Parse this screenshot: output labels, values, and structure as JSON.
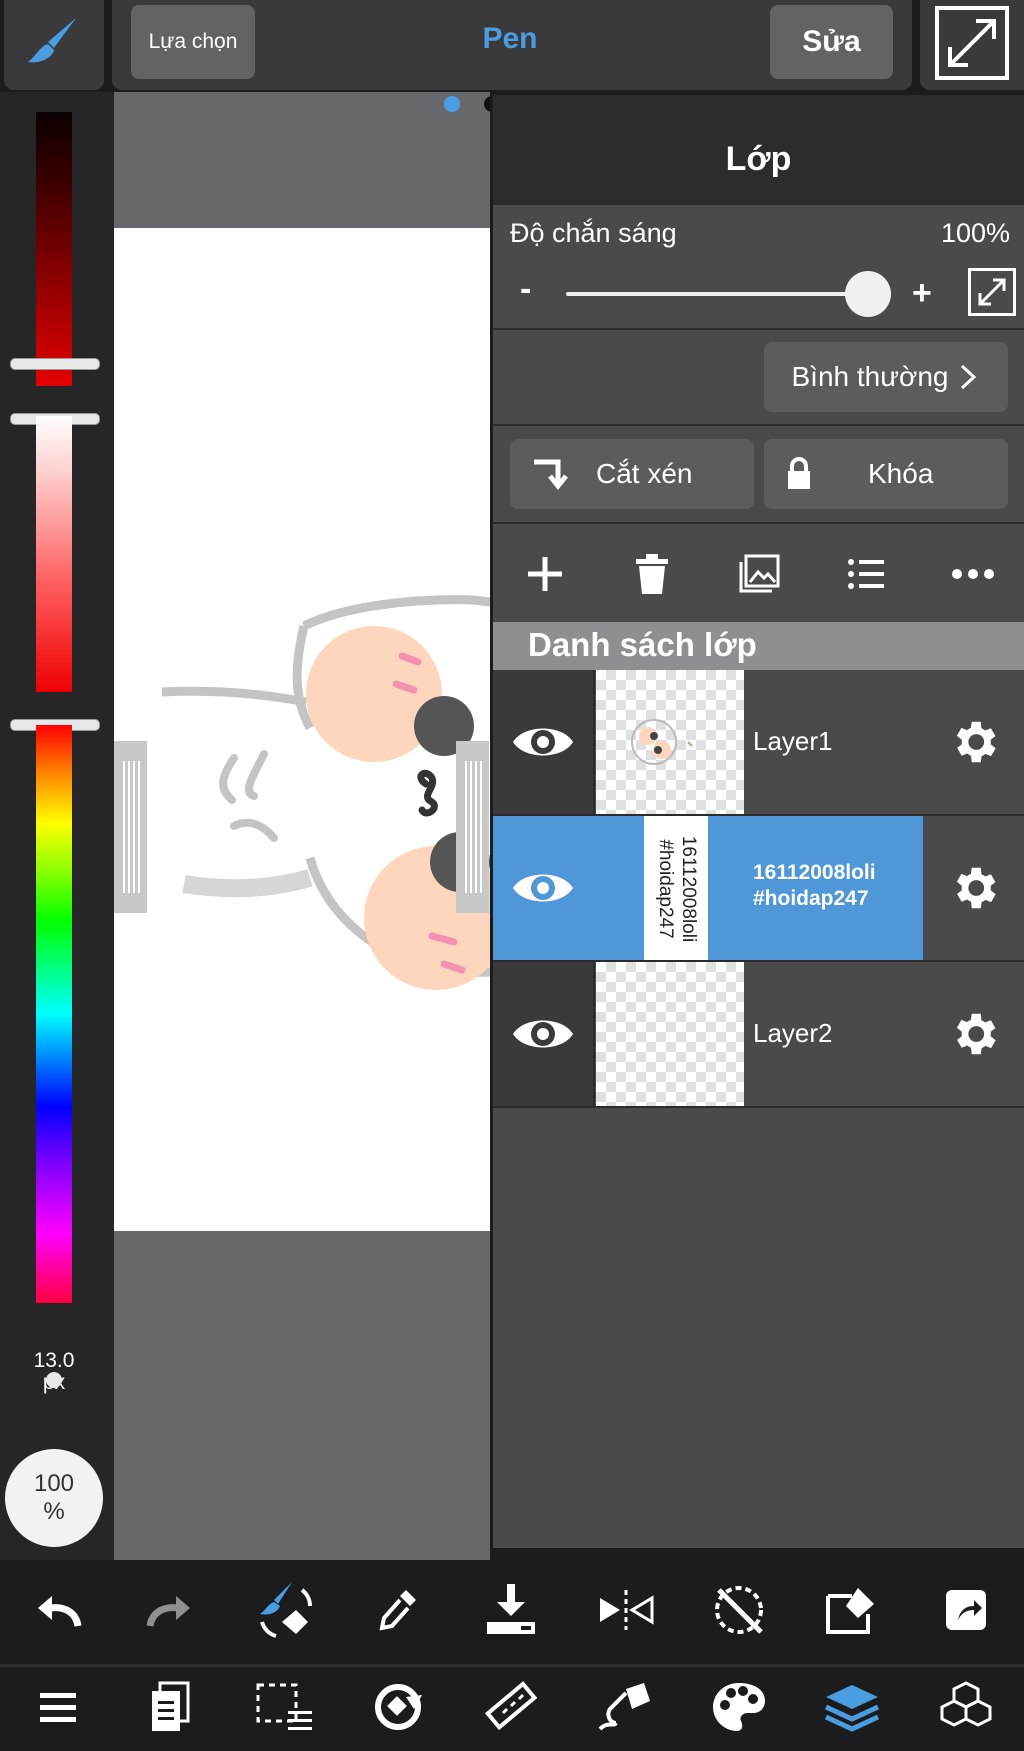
{
  "topbar": {
    "select_label": "Lựa chọn",
    "tool_title": "Pen",
    "edit_label": "Sửa"
  },
  "left_panel": {
    "brush_size_value": "13.0",
    "brush_size_unit": "px",
    "opacity_value": "100",
    "opacity_unit": "%"
  },
  "layer_panel": {
    "title": "Lớp",
    "opacity_label": "Độ chắn sáng",
    "opacity_value": "100%",
    "opacity_fraction": 1.0,
    "minus": "-",
    "plus": "+",
    "blend_mode": "Bình thường",
    "clip_label": "Cắt xén",
    "lock_label": "Khóa",
    "list_title": "Danh sách lớp",
    "layers": [
      {
        "name": "Layer1"
      },
      {
        "name_line1": "16112008loli",
        "name_line2": "#hoidap247",
        "thumb_line1": "16112008loli",
        "thumb_line2": "#hoidap247"
      },
      {
        "name": "Layer2"
      }
    ]
  },
  "colors": {
    "accent": "#4a9de0",
    "selected_layer": "#4f97d6",
    "panel_bg": "#4a4a4c",
    "toolbar_bg": "#1c1c1e"
  },
  "icons": {
    "top": [
      "brush-icon",
      "expand-icon"
    ],
    "bottom_row1": [
      "undo-icon",
      "redo-icon",
      "brush-transform-icon",
      "eyedropper-icon",
      "save-icon",
      "flip-icon",
      "no-rotate-icon",
      "edit-icon",
      "share-icon"
    ],
    "bottom_row2": [
      "menu-icon",
      "pages-icon",
      "selection-icon",
      "rotate-canvas-icon",
      "ruler-icon",
      "fill-icon",
      "palette-icon",
      "layers-icon",
      "materials-icon"
    ]
  }
}
